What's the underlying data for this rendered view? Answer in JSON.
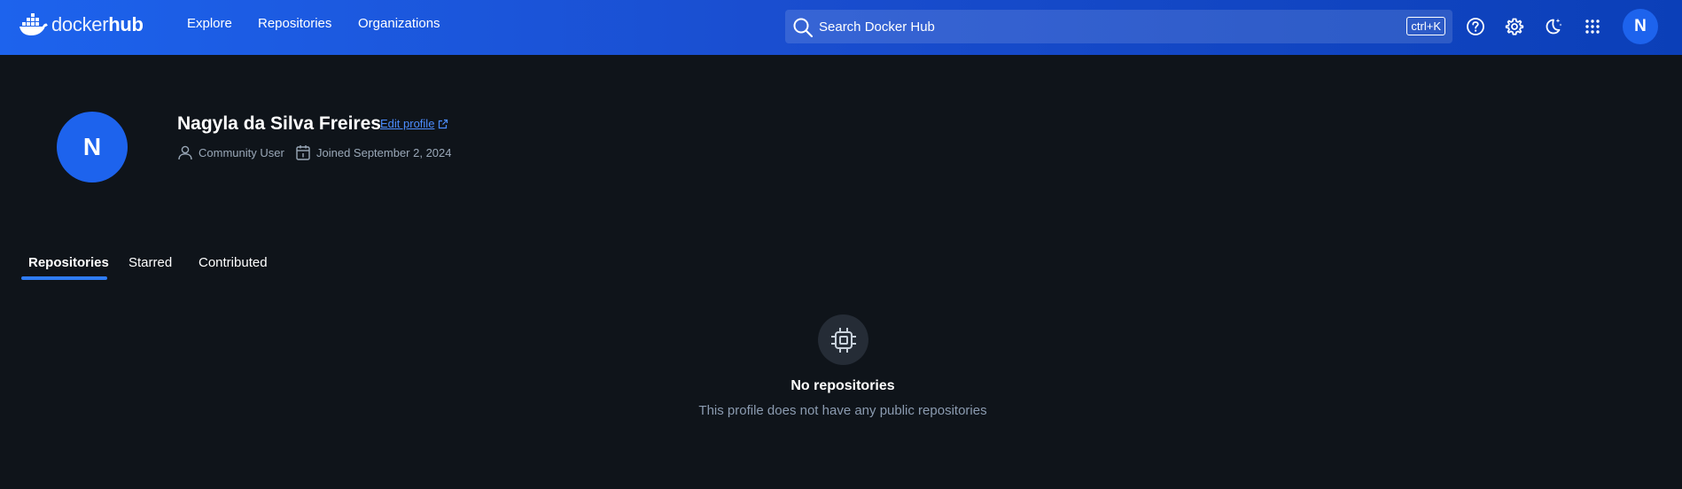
{
  "header": {
    "logo": {
      "light": "docker",
      "bold": "hub"
    },
    "nav": [
      {
        "label": "Explore"
      },
      {
        "label": "Repositories"
      },
      {
        "label": "Organizations"
      }
    ],
    "search": {
      "placeholder": "Search Docker Hub",
      "shortcut": "ctrl+K",
      "icon": "search-icon"
    },
    "icons": [
      "help-icon",
      "gear-icon",
      "theme-toggle-icon",
      "apps-grid-icon"
    ],
    "avatar_initial": "N"
  },
  "profile": {
    "avatar_initial": "N",
    "name": "Nagyla da Silva Freires",
    "edit_label": "Edit profile",
    "user_type": "Community User",
    "joined": "Joined September 2, 2024"
  },
  "tabs": [
    {
      "label": "Repositories",
      "active": true
    },
    {
      "label": "Starred",
      "active": false
    },
    {
      "label": "Contributed",
      "active": false
    }
  ],
  "empty_state": {
    "icon": "chip-icon",
    "title": "No repositories",
    "subtitle": "This profile does not have any public repositories"
  },
  "colors": {
    "brand_blue": "#1d63ed",
    "background": "#0f141a",
    "link": "#4c8dff",
    "muted_text": "#9aa8b8"
  }
}
